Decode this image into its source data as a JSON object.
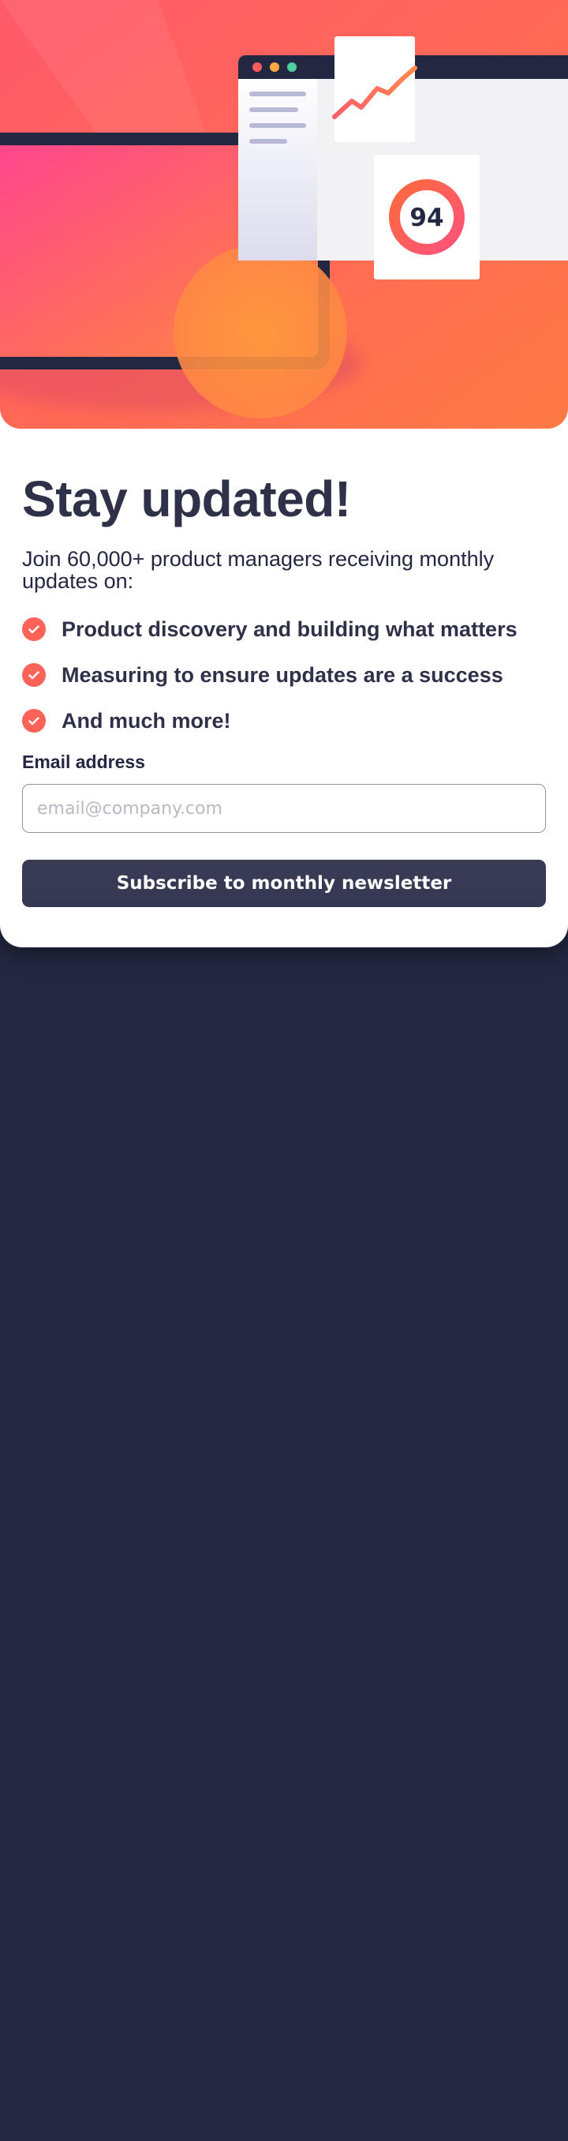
{
  "hero": {
    "score_value": "94"
  },
  "signup": {
    "title": "Stay updated!",
    "intro": "Join 60,000+ product managers receiving monthly updates on:",
    "features": [
      {
        "text": "Product discovery and building what matters",
        "icon": "check-icon"
      },
      {
        "text": "Measuring to ensure updates are a success",
        "icon": "check-icon"
      },
      {
        "text": "And much more!",
        "icon": "check-icon"
      }
    ],
    "email_label": "Email address",
    "email_placeholder": "email@company.com",
    "email_value": "",
    "submit_label": "Subscribe to monthly newsletter"
  },
  "colors": {
    "page_background": "#242742",
    "accent": "#ff6257",
    "text_dark": "#242742",
    "button": "#363853"
  }
}
